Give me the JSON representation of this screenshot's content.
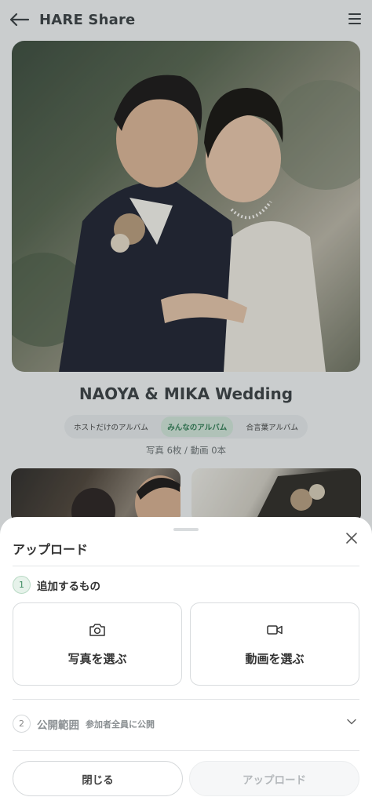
{
  "header": {
    "title": "HARE Share"
  },
  "event": {
    "title": "NAOYA & MIKA Wedding"
  },
  "album_tabs": [
    {
      "label": "ホストだけのアルバム",
      "active": false
    },
    {
      "label": "みんなのアルバム",
      "active": true
    },
    {
      "label": "合言葉アルバム",
      "active": false
    }
  ],
  "counts": "写真 6枚 / 動画 0本",
  "sheet": {
    "title": "アップロード",
    "step1": {
      "number": "1",
      "label": "追加するもの"
    },
    "pick_photo": "写真を選ぶ",
    "pick_video": "動画を選ぶ",
    "step2": {
      "number": "2",
      "label": "公開範囲",
      "value": "参加者全員に公開"
    },
    "close_button": "閉じる",
    "upload_button": "アップロード"
  },
  "colors": {
    "accent": "#3b8a5f",
    "accent_bg": "#e6f2ea",
    "sheet_bg": "#ffffff"
  }
}
